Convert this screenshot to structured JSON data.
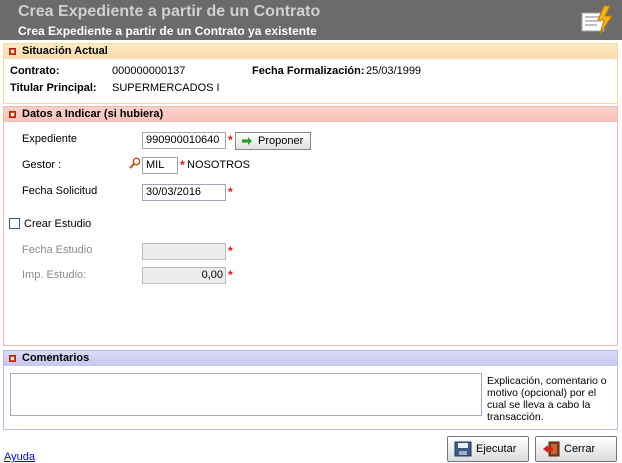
{
  "header": {
    "title": "Crea Expediente a partir de un Contrato",
    "subtitle": "Crea Expediente a partir de un Contrato ya existente"
  },
  "situacion": {
    "heading": "Situación Actual",
    "contrato_label": "Contrato:",
    "contrato_value": "000000000137",
    "fecha_form_label": "Fecha Formalización:",
    "fecha_form_value": "25/03/1999",
    "titular_label": "Titular Principal:",
    "titular_value": "SUPERMERCADOS I"
  },
  "datos": {
    "heading": "Datos a Indicar (si hubiera)",
    "expediente_label": "Expediente",
    "expediente_value": "990900010640",
    "proponer_label": "Proponer",
    "gestor_label": "Gestor :",
    "gestor_code": "MIL",
    "gestor_name": "NOSOTROS",
    "fecha_solicitud_label": "Fecha Solicitud",
    "fecha_solicitud_value": "30/03/2016",
    "crear_estudio_label": "Crear Estudio",
    "fecha_estudio_label": "Fecha Estudio",
    "fecha_estudio_value": "",
    "imp_estudio_label": "Imp. Estudio:",
    "imp_estudio_value": "0,00",
    "required_mark": "*"
  },
  "comentarios": {
    "heading": "Comentarios",
    "value": "",
    "help": "Explicación, comentario o motivo (opcional) por el cual se lleva a cabo la transacción."
  },
  "footer": {
    "ayuda_label": "Ayuda",
    "ejecutar_label": "Ejecutar",
    "cerrar_label": "Cerrar"
  },
  "colors": {
    "header_bg": "#6b6b6b",
    "section1_bg": "#fbdcae",
    "section2_bg": "#f7c1b8",
    "section3_bg": "#c8c8f0",
    "required": "#e81010"
  }
}
